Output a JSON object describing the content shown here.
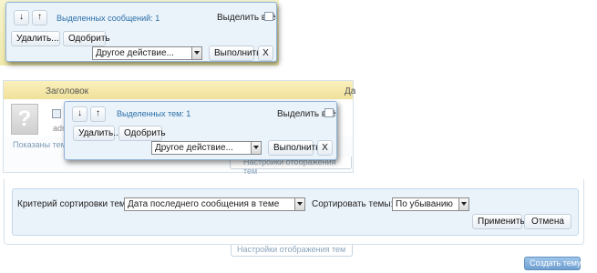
{
  "panel1": {
    "down_arrow": "↓",
    "up_arrow": "↑",
    "selected_label": "Выделенных сообщений: 1",
    "select_all_label": "Выделить всё",
    "delete_label": "Удалить...",
    "approve_label": "Одобрить",
    "other_action": "Другое действие...",
    "execute_label": "Выполнить",
    "close_label": "X"
  },
  "panel2": {
    "header_column": "Заголовок",
    "header_right": "Да",
    "shown_threads_partial": "Показаны темы",
    "row_author_partial": "adm",
    "down_arrow": "↓",
    "up_arrow": "↑",
    "selected_label": "Выделенных тем: 1",
    "select_all_label": "Выделить всё",
    "delete_label": "Удалить...",
    "approve_label": "Одобрить",
    "other_action": "Другое действие...",
    "execute_label": "Выполнить",
    "close_label": "X",
    "display_settings": "Настройки отображения тем"
  },
  "panel3": {
    "sort_criterion_label": "Критерий сортировки тем:",
    "sort_criterion_value": "Дата последнего сообщения в теме",
    "sort_order_label": "Сортировать темы:",
    "sort_order_value": "По убыванию",
    "apply_label": "Применить",
    "cancel_label": "Отмена",
    "display_settings": "Настройки отображения тем",
    "create_thread": "Создать тему"
  },
  "colors": {
    "popup_bg": "#ebf3fa",
    "popup_border": "#8fb3d6",
    "header_yellow": "#f6e9a6",
    "link_blue": "#2b6fa8",
    "create_button": "#6f9fd0"
  }
}
